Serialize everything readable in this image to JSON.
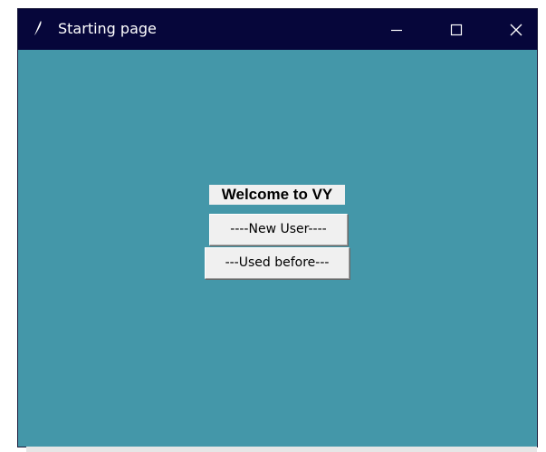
{
  "window": {
    "title": "Starting page",
    "icon": "feather-icon",
    "background_color": "#4497a9",
    "titlebar_color": "#06063a",
    "controls": {
      "minimize": "minimize-icon",
      "maximize": "maximize-icon",
      "close": "close-icon"
    }
  },
  "main": {
    "welcome_label": "Welcome to VY",
    "new_user_button": "----New User----",
    "used_before_button": "---Used before---"
  }
}
